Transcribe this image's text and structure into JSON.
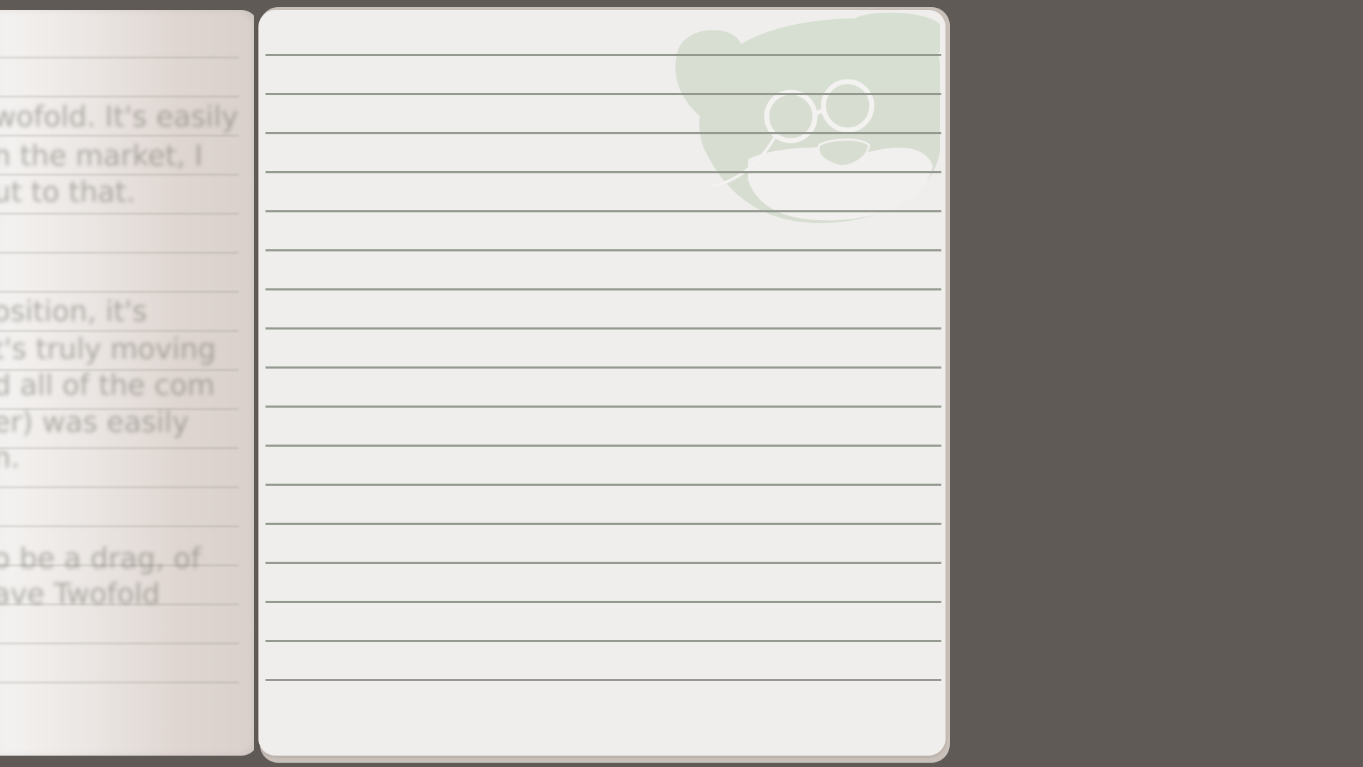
{
  "app": {
    "view": "notebook"
  },
  "left_page": {
    "visible_text_lines": [
      "wofold. It's easily",
      "n the market, I",
      "ut to that.",
      "osition, it's",
      "t's truly moving",
      "d all of the com",
      "er) was easily",
      "n.",
      "o be a drag, of",
      "ave Twofold"
    ]
  },
  "right_page": {
    "content": "",
    "watermark": "bear-with-glasses-icon"
  },
  "colors": {
    "background": "#5f5a55",
    "page": "#efeeed",
    "rule": "#959a90",
    "watermark": "#d4dccd"
  }
}
